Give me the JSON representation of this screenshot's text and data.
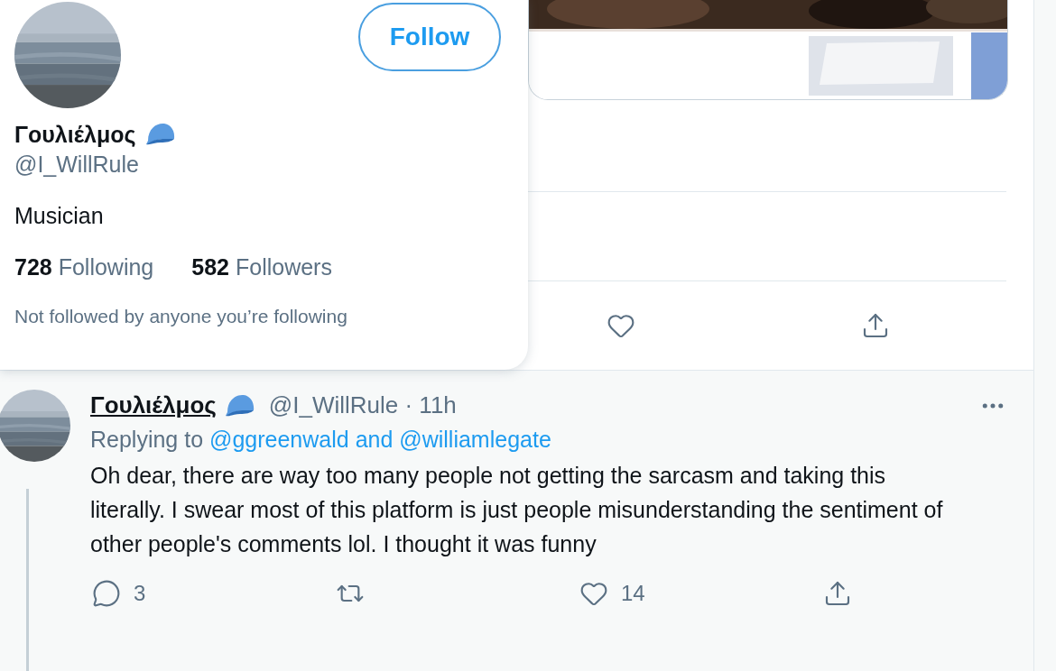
{
  "hover_card": {
    "name": "Γουλιέλμος",
    "handle": "@I_WillRule",
    "bio": "Musician",
    "follow_button": "Follow",
    "stats": [
      {
        "count": "728",
        "label": "Following"
      },
      {
        "count": "582",
        "label": "Followers"
      }
    ],
    "note": "Not followed by anyone you’re following"
  },
  "top_tweet": {
    "actions": [
      {
        "kind": "like"
      },
      {
        "kind": "share"
      }
    ]
  },
  "reply": {
    "name": "Γουλιέλμος",
    "meta": "@I_WillRule · 11h",
    "replying_label": "Replying to",
    "mentions": [
      "@ggreenwald",
      "@williamlegate"
    ],
    "conjunction": "and",
    "text": "Oh dear, there are way too many people not getting the sarcasm and taking this literally. I swear most of this platform is just people misunderstanding the sentiment of other people's comments lol. I thought it was funny",
    "actions": [
      {
        "kind": "reply",
        "count": "3"
      },
      {
        "kind": "retweet"
      },
      {
        "kind": "like",
        "count": "14"
      },
      {
        "kind": "share"
      }
    ]
  }
}
